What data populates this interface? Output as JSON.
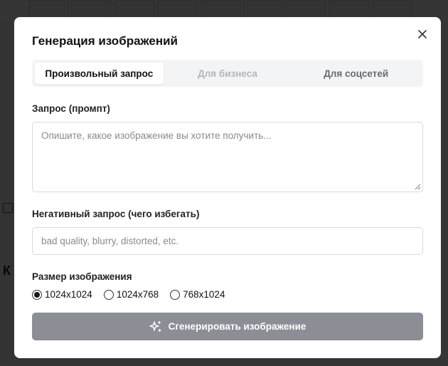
{
  "dialog": {
    "title": "Генерация изображений",
    "tabs": [
      {
        "label": "Произвольный запрос",
        "state": "active"
      },
      {
        "label": "Для бизнеса",
        "state": "disabled"
      },
      {
        "label": "Для соцсетей",
        "state": "normal"
      }
    ],
    "prompt": {
      "label": "Запрос (промпт)",
      "placeholder": "Опишите, какое изображение вы хотите получить...",
      "value": ""
    },
    "negative_prompt": {
      "label": "Негативный запрос (чего избегать)",
      "placeholder": "bad quality, blurry, distorted, etc.",
      "value": ""
    },
    "size": {
      "label": "Размер изображения",
      "options": [
        "1024x1024",
        "1024x768",
        "768x1024"
      ],
      "selected": "1024x1024"
    },
    "generate_button": {
      "label": "Сгенерировать изображение",
      "icon": "sparkles-icon",
      "color": "#8b8e94"
    },
    "close_icon": "close-icon"
  },
  "colors": {
    "overlay": "#000000",
    "modal_bg": "#ffffff",
    "tabs_bg": "#f3f4f6"
  }
}
